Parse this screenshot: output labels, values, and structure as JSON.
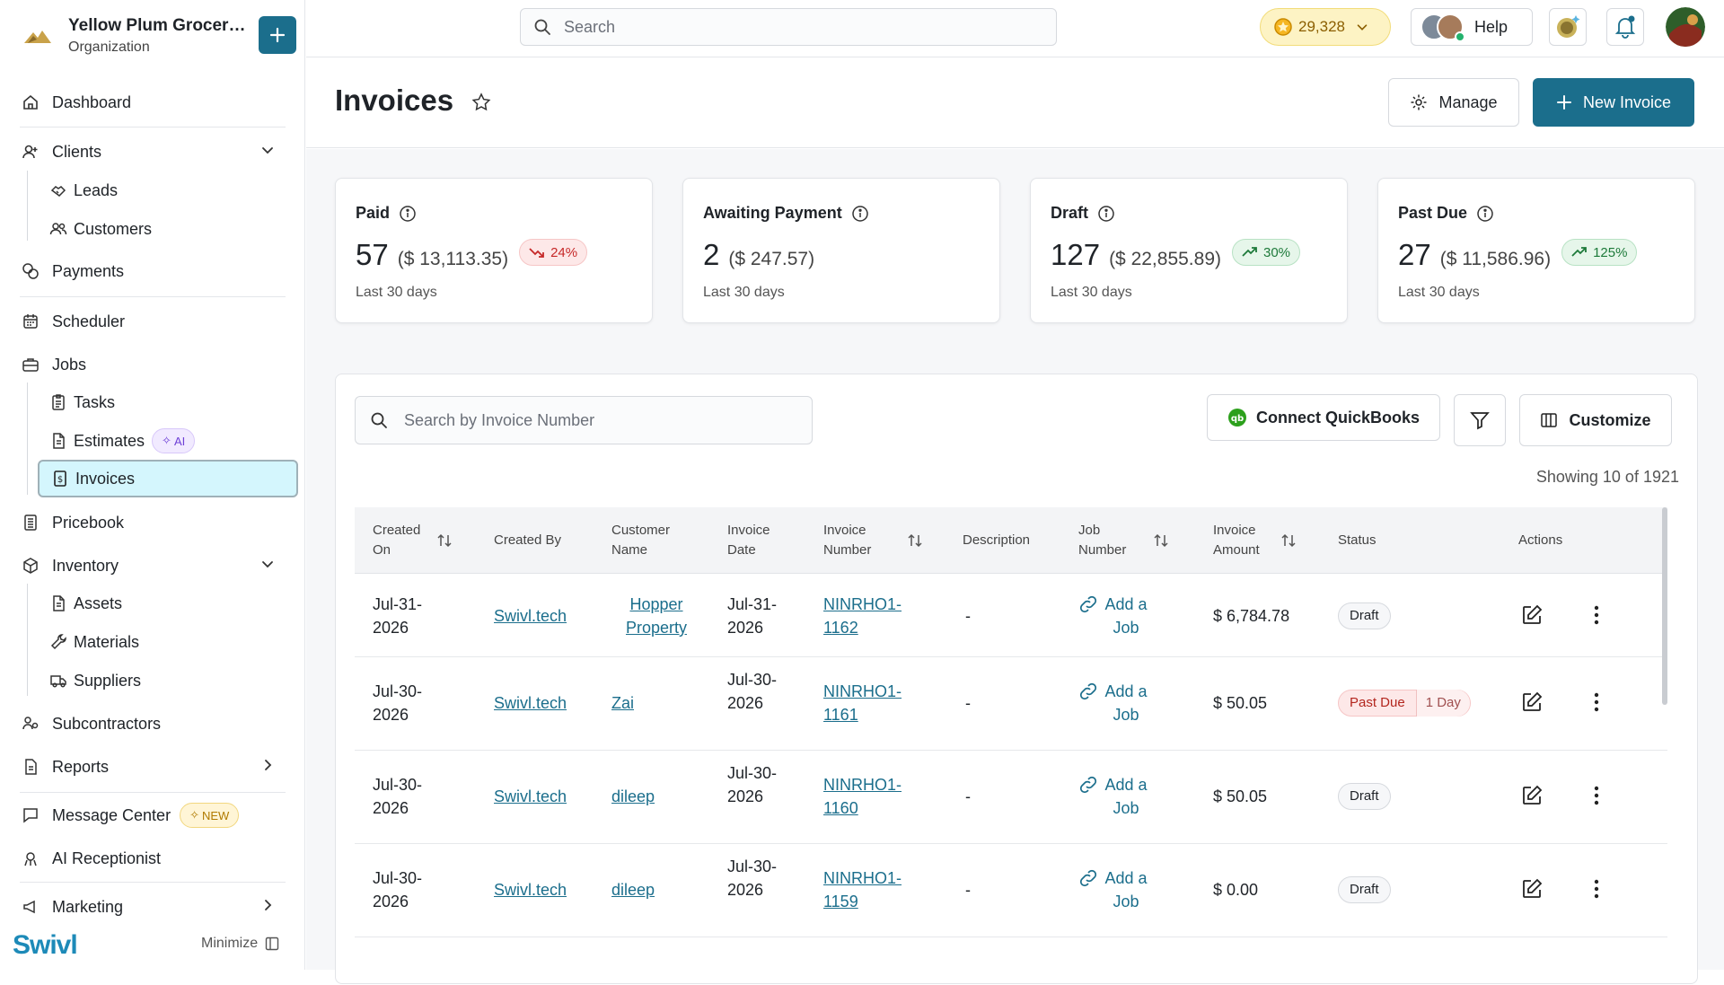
{
  "org": {
    "name": "Yellow Plum Grocers...",
    "type": "Organization"
  },
  "nav": {
    "dashboard": "Dashboard",
    "clients": "Clients",
    "leads": "Leads",
    "customers": "Customers",
    "payments": "Payments",
    "scheduler": "Scheduler",
    "jobs": "Jobs",
    "tasks": "Tasks",
    "estimates": "Estimates",
    "estimates_badge": "AI",
    "invoices": "Invoices",
    "pricebook": "Pricebook",
    "inventory": "Inventory",
    "assets": "Assets",
    "materials": "Materials",
    "suppliers": "Suppliers",
    "subcontractors": "Subcontractors",
    "reports": "Reports",
    "message_center": "Message Center",
    "message_center_badge": "NEW",
    "ai_receptionist": "AI Receptionist",
    "marketing": "Marketing"
  },
  "brand": "Swivl",
  "minimize_label": "Minimize",
  "topbar": {
    "search_placeholder": "Search",
    "coins": "29,328",
    "help": "Help"
  },
  "page": {
    "title": "Invoices",
    "manage": "Manage",
    "new_invoice": "New Invoice"
  },
  "stats": [
    {
      "label": "Paid",
      "count": "57",
      "amount": "($ 13,113.35)",
      "trend": "24%",
      "trend_dir": "down",
      "period": "Last 30 days"
    },
    {
      "label": "Awaiting Payment",
      "count": "2",
      "amount": "($ 247.57)",
      "trend": "",
      "trend_dir": "none",
      "period": "Last 30 days"
    },
    {
      "label": "Draft",
      "count": "127",
      "amount": "($ 22,855.89)",
      "trend": "30%",
      "trend_dir": "up",
      "period": "Last 30 days"
    },
    {
      "label": "Past Due",
      "count": "27",
      "amount": "($ 11,586.96)",
      "trend": "125%",
      "trend_dir": "up",
      "period": "Last 30 days"
    }
  ],
  "toolbar": {
    "search_placeholder": "Search by Invoice Number",
    "connect_quickbooks": "Connect QuickBooks",
    "customize": "Customize",
    "showing": "Showing 10 of 1921"
  },
  "columns": {
    "created_on": "Created On",
    "created_by": "Created By",
    "customer_name": "Customer Name",
    "invoice_date": "Invoice Date",
    "invoice_number": "Invoice Number",
    "description": "Description",
    "job_number": "Job Number",
    "invoice_amount": "Invoice Amount",
    "status": "Status",
    "actions": "Actions"
  },
  "rows": [
    {
      "created_on": "Jul-31-2026",
      "created_by": "Swivl.tech",
      "customer": "Hopper Property",
      "invoice_date": "Jul-31-2026",
      "invoice_number": "NINRHO1-1162",
      "description": "-",
      "job": "Add a Job",
      "amount": "$ 6,784.78",
      "status": "Draft",
      "status_sub": ""
    },
    {
      "created_on": "Jul-30-2026",
      "created_by": "Swivl.tech",
      "customer": "Zai",
      "invoice_date": "Jul-30-2026",
      "invoice_number": "NINRHO1-1161",
      "description": "-",
      "job": "Add a Job",
      "amount": "$ 50.05",
      "status": "Past Due",
      "status_sub": "1 Day"
    },
    {
      "created_on": "Jul-30-2026",
      "created_by": "Swivl.tech",
      "customer": "dileep",
      "invoice_date": "Jul-30-2026",
      "invoice_number": "NINRHO1-1160",
      "description": "-",
      "job": "Add a Job",
      "amount": "$ 50.05",
      "status": "Draft",
      "status_sub": ""
    },
    {
      "created_on": "Jul-30-2026",
      "created_by": "Swivl.tech",
      "customer": "dileep",
      "invoice_date": "Jul-30-2026",
      "invoice_number": "NINRHO1-1159",
      "description": "-",
      "job": "Add a Job",
      "amount": "$ 0.00",
      "status": "Draft",
      "status_sub": ""
    }
  ],
  "colors": {
    "primary": "#1b6e8c",
    "active_nav": "#d4f6fd"
  }
}
